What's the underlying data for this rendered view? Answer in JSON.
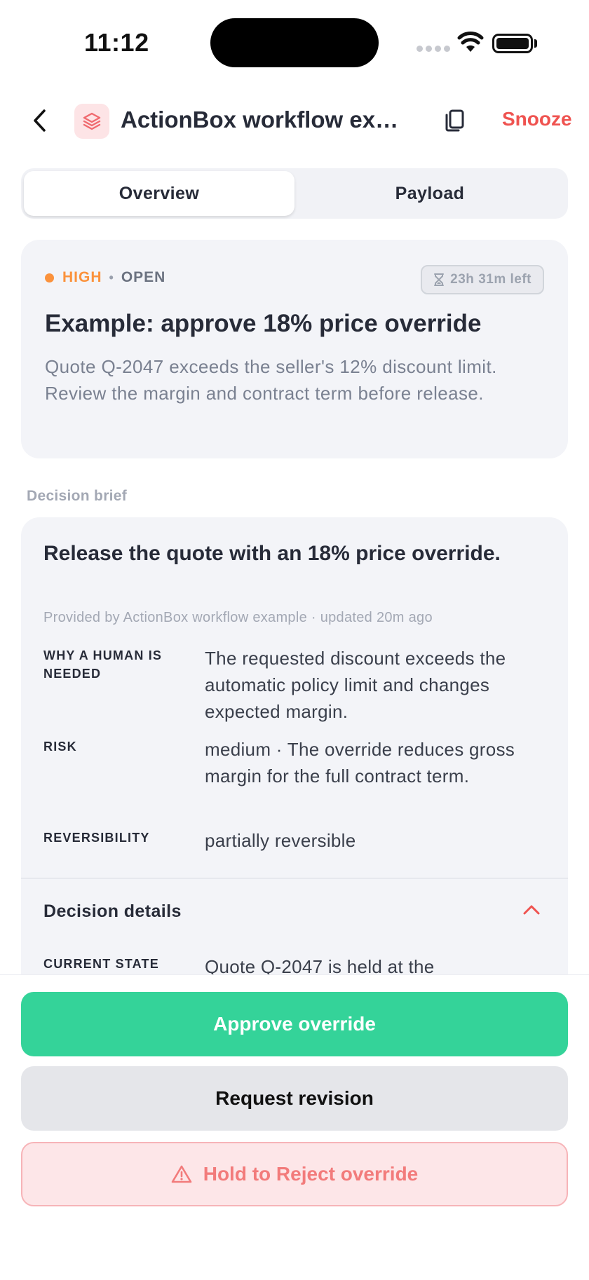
{
  "status_bar": {
    "time": "11:12"
  },
  "header": {
    "title": "ActionBox workflow example",
    "snooze_label": "Snooze",
    "app_icon": "layers-icon",
    "accent_color": "#ef5350"
  },
  "tabs": [
    {
      "label": "Overview",
      "active": true
    },
    {
      "label": "Payload",
      "active": false
    }
  ],
  "summary": {
    "priority": "HIGH",
    "status": "OPEN",
    "time_left": "23h 31m left",
    "title": "Example: approve 18% price override",
    "description": "Quote Q-2047 exceeds the seller's 12% discount limit. Review the margin and contract term before release.",
    "priority_color": "#fb923c"
  },
  "decision_brief": {
    "section_label": "Decision brief",
    "headline": "Release the quote with an 18% price override.",
    "provider": "Provided by ActionBox workflow example · updated 20m ago",
    "fields": [
      {
        "key": "WHY A HUMAN IS NEEDED",
        "value": "The requested discount exceeds the automatic policy limit and changes expected margin."
      },
      {
        "key": "RISK",
        "value": "medium · The override reduces gross margin for the full contract term."
      },
      {
        "key": "REVERSIBILITY",
        "value": "partially reversible"
      }
    ],
    "details_label": "Decision details",
    "details_expanded": true,
    "details_fields": [
      {
        "key": "CURRENT STATE",
        "value": "Quote Q-2047 is held at the"
      }
    ]
  },
  "actions": {
    "approve_label": "Approve override",
    "revise_label": "Request revision",
    "reject_label": "Hold to Reject override",
    "approve_color": "#34d399",
    "reject_color": "#f27b7b"
  }
}
